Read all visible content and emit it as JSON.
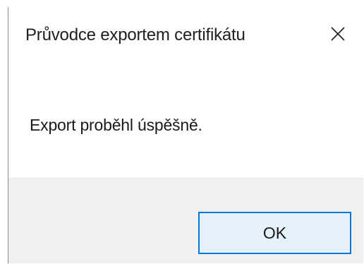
{
  "window": {
    "title": "Průvodce exportem certifikátu",
    "close_icon": "close-icon"
  },
  "content": {
    "message": "Export proběhl úspěšně."
  },
  "footer": {
    "ok_label": "OK"
  },
  "colors": {
    "accent": "#0078d7",
    "button_bg": "#e5f1fb",
    "footer_bg": "#f0f0f0"
  }
}
